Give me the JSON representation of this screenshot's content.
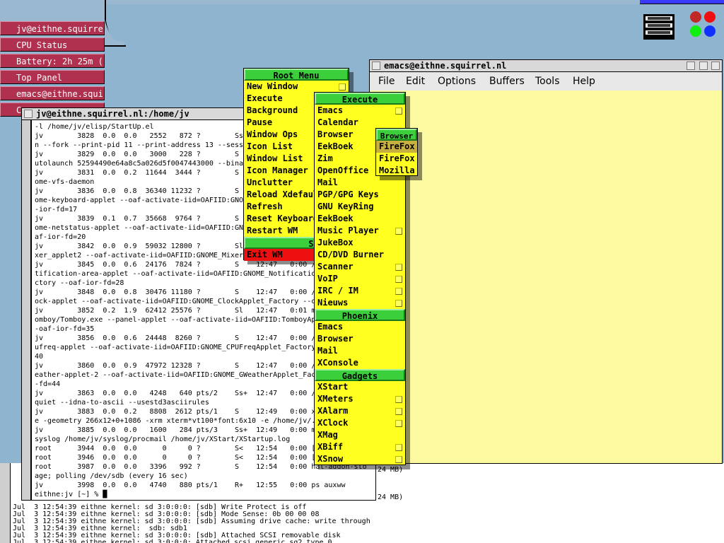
{
  "panel": {
    "items": [
      "jv@eithne.squirrel",
      "CPU Status",
      "Battery: 2h 25m (-",
      "Top Panel",
      "emacs@eithne.squir",
      "C"
    ]
  },
  "emacs": {
    "title": "emacs@eithne.squirrel.nl",
    "menu": [
      "File",
      "Edit",
      "Options",
      "Buffers",
      "Tools",
      "Help"
    ]
  },
  "terminal": {
    "title": "jv@eithne.squirrel.nl:/home/jv",
    "lines": [
      "-l /home/jv/elisp/StartUp.el",
      "jv        3828  0.0  0.0   2552   872 ?        Ss",
      "n --fork --print-pid 11 --print-address 13 --sess",
      "jv        3829  0.0  0.0   3000   228 ?        S",
      "utolaunch 52594490e64a8c5a026d5f0047443000 --bina",
      "jv        3831  0.0  0.2  11644  3444 ?        S",
      "ome-vfs-daemon",
      "jv        3836  0.0  0.8  36340 11232 ?        S",
      "ome-keyboard-applet --oaf-activate-iid=OAFIID:GNOM",
      "-ior-fd=17",
      "jv        3839  0.1  0.7  35668  9764 ?        S",
      "ome-netstatus-applet --oaf-activate-iid=OAFIID:GNOM",
      "af-ior-fd=20",
      "jv        3842  0.0  0.9  59032 12800 ?        Sl",
      "xer_applet2 --oaf-activate-iid=OAFIID:GNOME_Mixerp",
      "jv        3845  0.0  0.6  24176  7824 ?        S    12:47   0:00 /",
      "tification-area-applet --oaf-activate-iid=OAFIID:GNOME_Notification",
      "ctory --oaf-ior-fd=28",
      "jv        3848  0.0  0.8  30476 11180 ?        S    12:47   0:00 /",
      "ock-applet --oaf-activate-iid=OAFIID:GNOME_ClockApplet_Factory --o",
      "jv        3852  0.2  1.9  62412 25576 ?        Sl   12:47   0:01 m",
      "omboy/Tomboy.exe --panel-applet --oaf-activate-iid=OAFIID:TomboyAp",
      "-oaf-ior-fd=35",
      "jv        3856  0.0  0.6  24448  8260 ?        S    12:47   0:00 /",
      "ufreq-applet --oaf-activate-iid=OAFIID:GNOME_CPUFreqApplet_Factory",
      "40",
      "jv        3860  0.0  0.9  47972 12328 ?        S    12:47   0:00 /",
      "eather-applet-2 --oaf-activate-iid=OAFIID:GNOME_GWeatherApplet_Fac",
      "-fd=44",
      "jv        3863  0.0  0.0   4248   640 pts/2    Ss+  12:47   0:00 /",
      "quiet --idna-to-ascii --usestd3asciirules",
      "jv        3883  0.0  0.2   8808  2612 pts/1    S    12:49   0:00 x",
      "e -geometry 266x12+0+1086 -xrm xterm*vt100*font:6x10 -e /home/jv/.",
      "jv        3885  0.0  0.0   1600   284 pts/3    Ss+  12:49   0:00 m",
      "syslog /home/jv/syslog/procmail /home/jv/XStart/XStartup.log",
      "root      3944  0.0  0.0      0     0 ?        S<   12:54   0:00 [",
      "root      3946  0.0  0.0      0     0 ?        S<   12:54   0:00 [",
      "root      3987  0.0  0.0   3396   992 ?        S    12:54   0:00 hal-addon-sto",
      "age; polling /dev/sdb (every 16 sec)",
      "jv        3998  0.0  0.0   4740   880 pts/1    R+   12:55   0:00 ps auxww",
      "eithne:jv [~] % █"
    ]
  },
  "console": {
    "lines": [
      "Jul  3 12:54:39 eithne kernel: sd 3:0:0:0: [sdb] Write Protect is off",
      "Jul  3 12:54:39 eithne kernel: sd 3:0:0:0: [sdb] Mode Sense: 0b 00 00 08",
      "Jul  3 12:54:39 eithne kernel: sd 3:0:0:0: [sdb] Assuming drive cache: write through",
      "Jul  3 12:54:39 eithne kernel:  sdb: sdb1",
      "Jul  3 12:54:39 eithne kernel: sd 3:0:0:0: [sdb] Attached SCSI removable disk",
      "Jul  3 12:54:39 eithne kernel: sd 3:0:0:0: Attached scsi generic sg2 type 0"
    ],
    "right_fragments": [
      "24 MB)",
      "24 MB)"
    ]
  },
  "root_menu": {
    "title": "Root Menu",
    "items": [
      {
        "label": "New Window",
        "sub": true
      },
      {
        "label": "Execute",
        "sub": false
      },
      {
        "label": "Background",
        "sub": false
      },
      {
        "label": "Pause",
        "sub": false
      },
      {
        "label": "Window Ops",
        "sub": false
      },
      {
        "label": "Icon List",
        "sub": false
      },
      {
        "label": "Window List",
        "sub": false
      },
      {
        "label": "Icon Manager",
        "sub": false
      },
      {
        "label": "Unclutter",
        "sub": false
      },
      {
        "label": "Reload Xdefaul",
        "sub": false
      },
      {
        "label": "Refresh",
        "sub": false
      },
      {
        "label": "Reset Keyboard",
        "sub": false
      },
      {
        "label": "Restart WM",
        "sub": false
      }
    ],
    "session_title": "Session",
    "exit_label": "Exit WM"
  },
  "execute_menu": {
    "title": "Execute",
    "items": [
      {
        "label": "Emacs",
        "sub": true
      },
      {
        "label": "Calendar",
        "sub": false
      },
      {
        "label": "Browser",
        "sub": true
      },
      {
        "label": "EekBoek",
        "sub": true
      },
      {
        "label": "Zim",
        "sub": false
      },
      {
        "label": "OpenOffice",
        "sub": true
      },
      {
        "label": "Mail",
        "sub": false
      },
      {
        "label": "PGP/GPG Keys",
        "sub": false
      },
      {
        "label": "GNU KeyRing",
        "sub": false
      },
      {
        "label": "EekBoek",
        "sub": false
      },
      {
        "label": "Music Player",
        "sub": true
      },
      {
        "label": "JukeBox",
        "sub": false
      },
      {
        "label": "CD/DVD Burner",
        "sub": false
      },
      {
        "label": "Scanner",
        "sub": true
      },
      {
        "label": "VoIP",
        "sub": true
      },
      {
        "label": "IRC / IM",
        "sub": true
      },
      {
        "label": "Nieuws",
        "sub": true
      }
    ],
    "phoenix_title": "Phoenix",
    "phoenix_items": [
      "Emacs",
      "Browser",
      "Mail",
      "XConsole"
    ],
    "gadgets_title": "Gadgets",
    "gadgets_items": [
      {
        "label": "XStart",
        "sub": false
      },
      {
        "label": "XMeters",
        "sub": true
      },
      {
        "label": "XAlarm",
        "sub": true
      },
      {
        "label": "XClock",
        "sub": true
      },
      {
        "label": "XMag",
        "sub": false
      },
      {
        "label": "XBiff",
        "sub": true
      },
      {
        "label": "XSnow",
        "sub": true
      }
    ]
  },
  "browser_menu": {
    "title": "Browser",
    "items": [
      "FireFox",
      "FireFox",
      "Mozilla"
    ],
    "selected_index": 0
  },
  "colors": {
    "desktop": "#8fb4cf",
    "menu_bg": "#ffff20",
    "menu_header": "#3ccf3c",
    "panel_btn": "#b03050",
    "emacs_bg": "#fdf9a0",
    "exit_bg": "#ee1010"
  }
}
